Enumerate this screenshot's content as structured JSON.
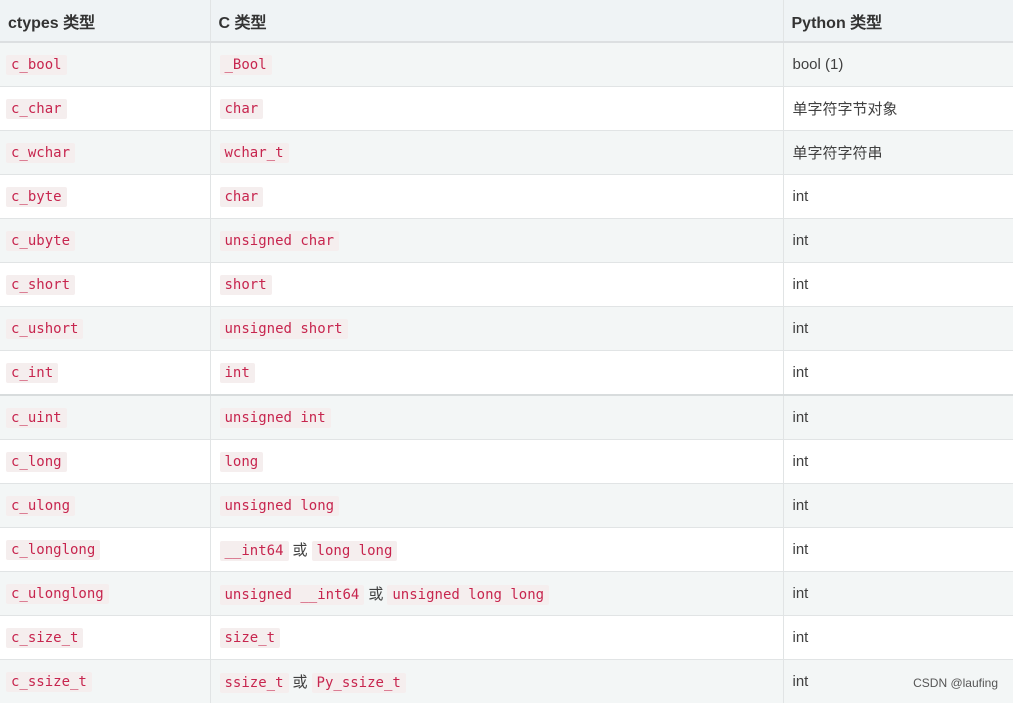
{
  "headers": [
    "ctypes 类型",
    "C 类型",
    "Python 类型"
  ],
  "rows": [
    {
      "ctype": "c_bool",
      "c": [
        {
          "code": "_Bool"
        }
      ],
      "py": "bool (1)"
    },
    {
      "ctype": "c_char",
      "c": [
        {
          "code": "char"
        }
      ],
      "py": "单字符字节对象"
    },
    {
      "ctype": "c_wchar",
      "c": [
        {
          "code": "wchar_t"
        }
      ],
      "py": "单字符字符串"
    },
    {
      "ctype": "c_byte",
      "c": [
        {
          "code": "char"
        }
      ],
      "py": "int"
    },
    {
      "ctype": "c_ubyte",
      "c": [
        {
          "code": "unsigned char"
        }
      ],
      "py": "int"
    },
    {
      "ctype": "c_short",
      "c": [
        {
          "code": "short"
        }
      ],
      "py": "int"
    },
    {
      "ctype": "c_ushort",
      "c": [
        {
          "code": "unsigned short"
        }
      ],
      "py": "int"
    },
    {
      "ctype": "c_int",
      "c": [
        {
          "code": "int"
        }
      ],
      "py": "int"
    },
    {
      "ctype": "c_uint",
      "c": [
        {
          "code": "unsigned int"
        }
      ],
      "py": "int"
    },
    {
      "ctype": "c_long",
      "c": [
        {
          "code": "long"
        }
      ],
      "py": "int"
    },
    {
      "ctype": "c_ulong",
      "c": [
        {
          "code": "unsigned long"
        }
      ],
      "py": "int"
    },
    {
      "ctype": "c_longlong",
      "c": [
        {
          "code": "__int64"
        },
        {
          "text": "或"
        },
        {
          "code": "long long"
        }
      ],
      "py": "int"
    },
    {
      "ctype": "c_ulonglong",
      "c": [
        {
          "code": "unsigned __int64"
        },
        {
          "text": "或"
        },
        {
          "code": "unsigned long long"
        }
      ],
      "py": "int"
    },
    {
      "ctype": "c_size_t",
      "c": [
        {
          "code": "size_t"
        }
      ],
      "py": "int"
    },
    {
      "ctype": "c_ssize_t",
      "c": [
        {
          "code": "ssize_t"
        },
        {
          "text": "或"
        },
        {
          "code": "Py_ssize_t"
        }
      ],
      "py": "int"
    }
  ],
  "watermark": "CSDN @laufing"
}
